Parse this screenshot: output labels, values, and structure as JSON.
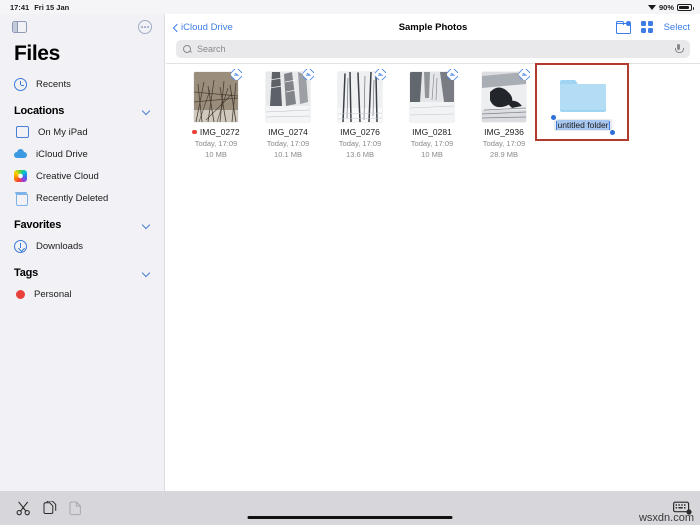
{
  "status_bar": {
    "time": "17:41",
    "date": "Fri 15 Jan",
    "wifi_icon": "wifi-icon",
    "battery_percent": "90%",
    "battery_icon": "battery-icon"
  },
  "sidebar": {
    "toggle_icon": "sidebar-toggle-icon",
    "more_icon": "more-options-icon",
    "app_title": "Files",
    "recents": {
      "label": "Recents",
      "icon": "clock-icon"
    },
    "sections": [
      {
        "header": "Locations",
        "collapse_icon": "chevron-down-icon",
        "items": [
          {
            "label": "On My iPad",
            "icon": "ipad-icon"
          },
          {
            "label": "iCloud Drive",
            "icon": "cloud-icon"
          },
          {
            "label": "Creative Cloud",
            "icon": "creative-cloud-icon"
          },
          {
            "label": "Recently Deleted",
            "icon": "trash-icon"
          }
        ]
      },
      {
        "header": "Favorites",
        "collapse_icon": "chevron-down-icon",
        "items": [
          {
            "label": "Downloads",
            "icon": "download-icon"
          }
        ]
      },
      {
        "header": "Tags",
        "collapse_icon": "chevron-down-icon",
        "items": [
          {
            "label": "Personal",
            "icon": "tag-dot-icon",
            "color": "#e8413a"
          }
        ]
      }
    ]
  },
  "navbar": {
    "back_label": "iCloud Drive",
    "back_icon": "chevron-left-icon",
    "title": "Sample Photos",
    "new_folder_icon": "new-folder-icon",
    "grid_view_icon": "grid-view-icon",
    "select_label": "Select"
  },
  "search": {
    "placeholder": "Search",
    "search_icon": "search-icon",
    "mic_icon": "microphone-icon"
  },
  "files": [
    {
      "name": "IMG_0272",
      "date": "Today, 17:09",
      "size": "10 MB",
      "tag_color": "#e8413a",
      "cloud_badge": "icloud-download-icon"
    },
    {
      "name": "IMG_0274",
      "date": "Today, 17:09",
      "size": "10.1 MB",
      "tag_color": "",
      "cloud_badge": "icloud-download-icon"
    },
    {
      "name": "IMG_0276",
      "date": "Today, 17:09",
      "size": "13.6 MB",
      "tag_color": "",
      "cloud_badge": "icloud-download-icon"
    },
    {
      "name": "IMG_0281",
      "date": "Today, 17:09",
      "size": "10 MB",
      "tag_color": "",
      "cloud_badge": "icloud-download-icon"
    },
    {
      "name": "IMG_2936",
      "date": "Today, 17:09",
      "size": "28.9 MB",
      "tag_color": "",
      "cloud_badge": "icloud-download-icon"
    }
  ],
  "new_folder": {
    "icon": "folder-icon",
    "name_value": "untitled folder",
    "is_editing": "true",
    "selection_color": "#a8c7f0",
    "annotation_color": "#b03a2e"
  },
  "bottom_bar": {
    "cut_icon": "cut-icon",
    "copy_icon": "copy-icon",
    "paste_icon": "paste-icon",
    "keyboard_dismiss_icon": "keyboard-dismiss-icon",
    "watermark": "wsxdn.com"
  },
  "colors": {
    "accent": "#3d7ee6",
    "sidebar_bg": "#f2f2f6",
    "bottom_bar_bg": "#d6d6db",
    "annotation_red": "#b03a2e",
    "tag_red": "#e8413a"
  }
}
